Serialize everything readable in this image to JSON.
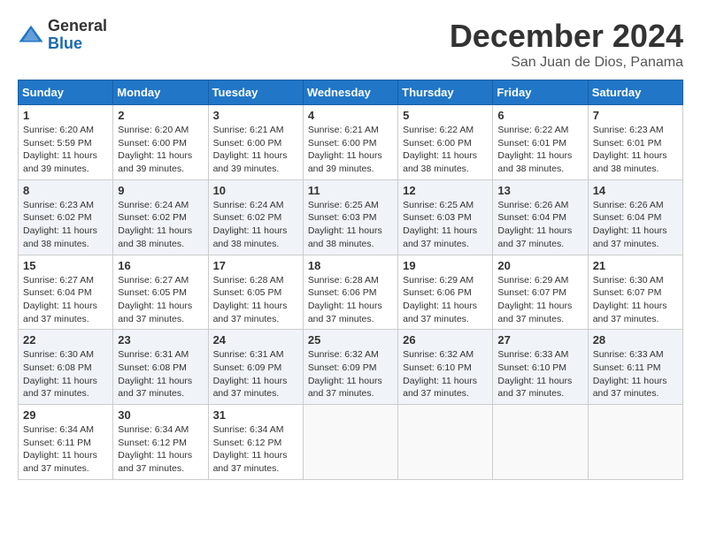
{
  "logo": {
    "general": "General",
    "blue": "Blue"
  },
  "title": {
    "month_year": "December 2024",
    "location": "San Juan de Dios, Panama"
  },
  "days_of_week": [
    "Sunday",
    "Monday",
    "Tuesday",
    "Wednesday",
    "Thursday",
    "Friday",
    "Saturday"
  ],
  "weeks": [
    [
      {
        "day": "1",
        "sunrise": "6:20 AM",
        "sunset": "5:59 PM",
        "daylight": "11 hours and 39 minutes."
      },
      {
        "day": "2",
        "sunrise": "6:20 AM",
        "sunset": "6:00 PM",
        "daylight": "11 hours and 39 minutes."
      },
      {
        "day": "3",
        "sunrise": "6:21 AM",
        "sunset": "6:00 PM",
        "daylight": "11 hours and 39 minutes."
      },
      {
        "day": "4",
        "sunrise": "6:21 AM",
        "sunset": "6:00 PM",
        "daylight": "11 hours and 39 minutes."
      },
      {
        "day": "5",
        "sunrise": "6:22 AM",
        "sunset": "6:00 PM",
        "daylight": "11 hours and 38 minutes."
      },
      {
        "day": "6",
        "sunrise": "6:22 AM",
        "sunset": "6:01 PM",
        "daylight": "11 hours and 38 minutes."
      },
      {
        "day": "7",
        "sunrise": "6:23 AM",
        "sunset": "6:01 PM",
        "daylight": "11 hours and 38 minutes."
      }
    ],
    [
      {
        "day": "8",
        "sunrise": "6:23 AM",
        "sunset": "6:02 PM",
        "daylight": "11 hours and 38 minutes."
      },
      {
        "day": "9",
        "sunrise": "6:24 AM",
        "sunset": "6:02 PM",
        "daylight": "11 hours and 38 minutes."
      },
      {
        "day": "10",
        "sunrise": "6:24 AM",
        "sunset": "6:02 PM",
        "daylight": "11 hours and 38 minutes."
      },
      {
        "day": "11",
        "sunrise": "6:25 AM",
        "sunset": "6:03 PM",
        "daylight": "11 hours and 38 minutes."
      },
      {
        "day": "12",
        "sunrise": "6:25 AM",
        "sunset": "6:03 PM",
        "daylight": "11 hours and 37 minutes."
      },
      {
        "day": "13",
        "sunrise": "6:26 AM",
        "sunset": "6:04 PM",
        "daylight": "11 hours and 37 minutes."
      },
      {
        "day": "14",
        "sunrise": "6:26 AM",
        "sunset": "6:04 PM",
        "daylight": "11 hours and 37 minutes."
      }
    ],
    [
      {
        "day": "15",
        "sunrise": "6:27 AM",
        "sunset": "6:04 PM",
        "daylight": "11 hours and 37 minutes."
      },
      {
        "day": "16",
        "sunrise": "6:27 AM",
        "sunset": "6:05 PM",
        "daylight": "11 hours and 37 minutes."
      },
      {
        "day": "17",
        "sunrise": "6:28 AM",
        "sunset": "6:05 PM",
        "daylight": "11 hours and 37 minutes."
      },
      {
        "day": "18",
        "sunrise": "6:28 AM",
        "sunset": "6:06 PM",
        "daylight": "11 hours and 37 minutes."
      },
      {
        "day": "19",
        "sunrise": "6:29 AM",
        "sunset": "6:06 PM",
        "daylight": "11 hours and 37 minutes."
      },
      {
        "day": "20",
        "sunrise": "6:29 AM",
        "sunset": "6:07 PM",
        "daylight": "11 hours and 37 minutes."
      },
      {
        "day": "21",
        "sunrise": "6:30 AM",
        "sunset": "6:07 PM",
        "daylight": "11 hours and 37 minutes."
      }
    ],
    [
      {
        "day": "22",
        "sunrise": "6:30 AM",
        "sunset": "6:08 PM",
        "daylight": "11 hours and 37 minutes."
      },
      {
        "day": "23",
        "sunrise": "6:31 AM",
        "sunset": "6:08 PM",
        "daylight": "11 hours and 37 minutes."
      },
      {
        "day": "24",
        "sunrise": "6:31 AM",
        "sunset": "6:09 PM",
        "daylight": "11 hours and 37 minutes."
      },
      {
        "day": "25",
        "sunrise": "6:32 AM",
        "sunset": "6:09 PM",
        "daylight": "11 hours and 37 minutes."
      },
      {
        "day": "26",
        "sunrise": "6:32 AM",
        "sunset": "6:10 PM",
        "daylight": "11 hours and 37 minutes."
      },
      {
        "day": "27",
        "sunrise": "6:33 AM",
        "sunset": "6:10 PM",
        "daylight": "11 hours and 37 minutes."
      },
      {
        "day": "28",
        "sunrise": "6:33 AM",
        "sunset": "6:11 PM",
        "daylight": "11 hours and 37 minutes."
      }
    ],
    [
      {
        "day": "29",
        "sunrise": "6:34 AM",
        "sunset": "6:11 PM",
        "daylight": "11 hours and 37 minutes."
      },
      {
        "day": "30",
        "sunrise": "6:34 AM",
        "sunset": "6:12 PM",
        "daylight": "11 hours and 37 minutes."
      },
      {
        "day": "31",
        "sunrise": "6:34 AM",
        "sunset": "6:12 PM",
        "daylight": "11 hours and 37 minutes."
      },
      null,
      null,
      null,
      null
    ]
  ],
  "labels": {
    "sunrise": "Sunrise:",
    "sunset": "Sunset:",
    "daylight": "Daylight:"
  }
}
